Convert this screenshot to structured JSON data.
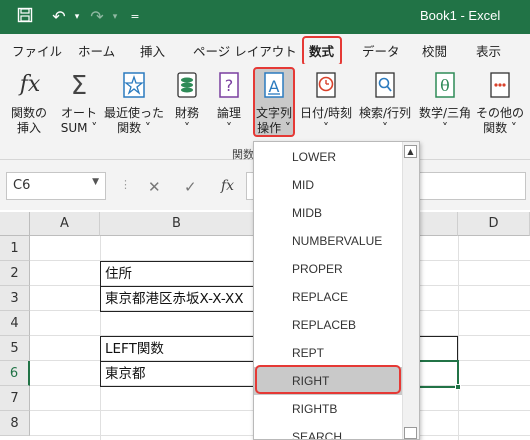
{
  "titlebar": {
    "title": "Book1  -  Excel",
    "bg": "#217346"
  },
  "menubar": {
    "items": [
      "ファイル",
      "ホーム",
      "挿入",
      "ページ レイアウト",
      "数式",
      "データ",
      "校閲",
      "表示"
    ],
    "active": "数式"
  },
  "ribbon": {
    "buttons": [
      {
        "line1": "関数の",
        "line2": "挿入",
        "icon": "fx-icon"
      },
      {
        "line1": "オート",
        "line2": "SUM ˅",
        "icon": "sigma-icon"
      },
      {
        "line1": "最近使った",
        "line2": "関数 ˅",
        "icon": "star-icon"
      },
      {
        "line1": "財務",
        "line2": "˅",
        "icon": "money-icon"
      },
      {
        "line1": "論理",
        "line2": "˅",
        "icon": "question-icon"
      },
      {
        "line1": "文字列",
        "line2": "操作 ˅",
        "icon": "text-a-icon"
      },
      {
        "line1": "日付/時刻",
        "line2": "˅",
        "icon": "clock-icon"
      },
      {
        "line1": "検索/行列",
        "line2": "˅",
        "icon": "lookup-icon"
      },
      {
        "line1": "数学/三角",
        "line2": "˅",
        "icon": "theta-icon"
      },
      {
        "line1": "その他の",
        "line2": "関数 ˅",
        "icon": "more-icon"
      }
    ],
    "group_label": "関数"
  },
  "formula_bar": {
    "name_box": "C6",
    "fx": "fx"
  },
  "sheet": {
    "columns": [
      "A",
      "B",
      "D"
    ],
    "rows": [
      "1",
      "2",
      "3",
      "4",
      "5",
      "6",
      "7",
      "8"
    ],
    "cells": {
      "B2": "住所",
      "B3": "東京都港区赤坂X-X-XX",
      "B5": "LEFT関数",
      "B6": "東京都"
    }
  },
  "dropdown": {
    "items": [
      "LOWER",
      "MID",
      "MIDB",
      "NUMBERVALUE",
      "PROPER",
      "REPLACE",
      "REPLACEB",
      "REPT",
      "RIGHT",
      "RIGHTB",
      "SEARCH"
    ],
    "selected": "RIGHT"
  },
  "colors": {
    "accent_red": "#e53935",
    "excel_green": "#217346"
  }
}
